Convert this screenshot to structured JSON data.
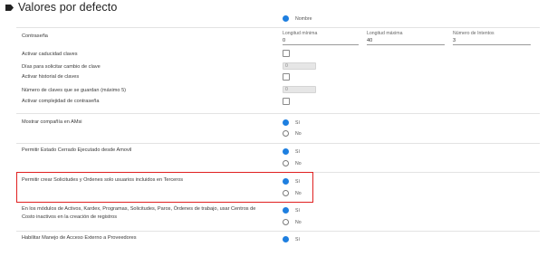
{
  "header": {
    "title": "Valores por defecto"
  },
  "top_option": {
    "label": "Nombre"
  },
  "password": {
    "label": "Contraseña",
    "min_length": {
      "label": "Longitud mínima",
      "value": "0"
    },
    "max_length": {
      "label": "Longitud máxima",
      "value": "40"
    },
    "attempts": {
      "label": "Número de Intentos",
      "value": "3"
    }
  },
  "settings": {
    "expiry": {
      "label": "Activar caducidad claves"
    },
    "days_change": {
      "label": "Días para solicitar cambio de clave",
      "value": "0"
    },
    "history": {
      "label": "Activar historial de claves"
    },
    "history_count": {
      "label": "Número de claves que se guardan (máximo 5)",
      "value": "0"
    },
    "complexity": {
      "label": "Activar complejidad de contraseña"
    }
  },
  "radio_rows": [
    {
      "label": "Mostrar compañía en AMsi",
      "yes": "Sí",
      "no": "No"
    },
    {
      "label": "Permitir Estado Cerrado Ejecutado desde Amovil",
      "yes": "Sí",
      "no": "No"
    },
    {
      "label": "Permitir crear Solicitudes y Ordenes solo usuarios incluidos en Terceros",
      "yes": "Sí",
      "no": "No"
    },
    {
      "label": "En los módulos de Activos, Kardex, Programas, Solicitudes, Paros, Órdenes de trabajo, usar Centros de Costo inactivos en la creación de registros",
      "yes": "Sí",
      "no": "No"
    },
    {
      "label": "Habilitar Manejo de Acceso Externo a Proveedores",
      "yes": "Sí"
    }
  ],
  "colors": {
    "accent": "#1e7fe0",
    "highlight": "#e02020"
  },
  "icons": {
    "header": "tag-icon"
  }
}
